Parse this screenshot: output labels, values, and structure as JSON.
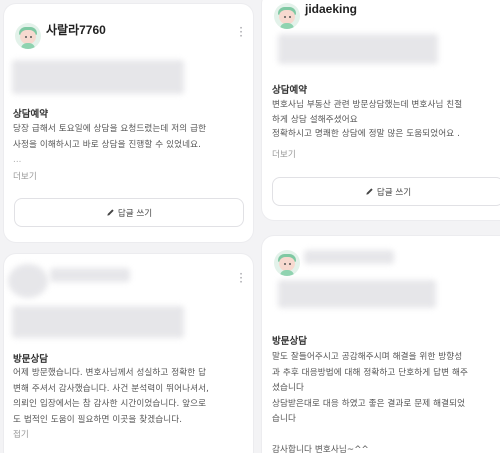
{
  "cards": [
    {
      "username": "사랄라7760",
      "category": "상담예약",
      "body_lines": [
        "당장 급해서 토요일에 상담을 요청드렸는데 저의 급한",
        "사정을 이해하시고 바로 상담을 진행할 수 있었네요."
      ],
      "ellipsis": "...",
      "more_label": "더보기",
      "reply_label": "답글 쓰기"
    },
    {
      "username": "jidaeking",
      "category": "상담예약",
      "body_lines": [
        "변호사님 부동산 관련 방문상담했는데 변호사님 친절",
        "하게 상담 설해주셨어요",
        "정확하시고 명쾌한 상담에 정말 많은 도움되었어요 ."
      ],
      "more_label": "더보기",
      "reply_label": "답글 쓰기"
    },
    {
      "category": "방문상담",
      "body_lines": [
        "어제 방문했습니다. 변호사님께서 성실하고 정확한 답",
        "변해 주셔서 감사했습니다. 사건 분석력이 뛰어나셔서,",
        "의뢰인 입장에서는 참 감사한 시간이었습니다. 앞으로",
        "도 법적인 도움이 필요하면 이곳을 찾겠습니다."
      ],
      "more_label": "접기"
    },
    {
      "category": "방문상담",
      "body_lines": [
        "말도 잘들어주시고 공감해주시며 해결을 위한 방향성",
        "과 추후 대응방법에 대해 정확하고 단호하게 답변 해주",
        "셨습니다",
        "상담받은대로 대응 하였고 좋은 결과로 문제 해결되었",
        "습니다",
        "",
        "감사합니다 변호사님~^^"
      ]
    }
  ]
}
